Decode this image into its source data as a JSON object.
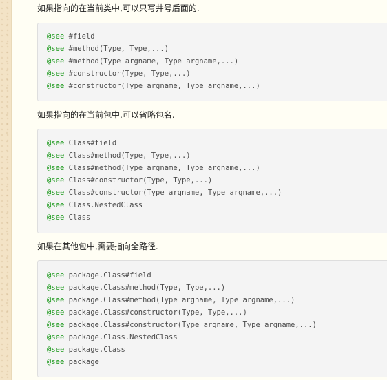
{
  "sections": [
    {
      "description": "如果指向的在当前类中,可以只写井号后面的.",
      "code_lines": [
        {
          "tag": "@see",
          "text": " #field"
        },
        {
          "tag": "@see",
          "text": " #method(Type, Type,...)"
        },
        {
          "tag": "@see",
          "text": " #method(Type argname, Type argname,...)"
        },
        {
          "tag": "@see",
          "text": " #constructor(Type, Type,...)"
        },
        {
          "tag": "@see",
          "text": " #constructor(Type argname, Type argname,...)"
        }
      ]
    },
    {
      "description": "如果指向的在当前包中,可以省略包名.",
      "code_lines": [
        {
          "tag": "@see",
          "text": " Class#field"
        },
        {
          "tag": "@see",
          "text": " Class#method(Type, Type,...)"
        },
        {
          "tag": "@see",
          "text": " Class#method(Type argname, Type argname,...)"
        },
        {
          "tag": "@see",
          "text": " Class#constructor(Type, Type,...)"
        },
        {
          "tag": "@see",
          "text": " Class#constructor(Type argname, Type argname,...)"
        },
        {
          "tag": "@see",
          "text": " Class.NestedClass"
        },
        {
          "tag": "@see",
          "text": " Class"
        }
      ]
    },
    {
      "description": "如果在其他包中,需要指向全路径.",
      "code_lines": [
        {
          "tag": "@see",
          "text": " package.Class#field"
        },
        {
          "tag": "@see",
          "text": " package.Class#method(Type, Type,...)"
        },
        {
          "tag": "@see",
          "text": " package.Class#method(Type argname, Type argname,...)"
        },
        {
          "tag": "@see",
          "text": " package.Class#constructor(Type, Type,...)"
        },
        {
          "tag": "@see",
          "text": " package.Class#constructor(Type argname, Type argname,...)"
        },
        {
          "tag": "@see",
          "text": " package.Class.NestedClass"
        },
        {
          "tag": "@see",
          "text": " package.Class"
        },
        {
          "tag": "@see",
          "text": " package"
        }
      ]
    }
  ],
  "colors": {
    "see_tag": "#1f9a1f",
    "code_text": "#4d4d4d",
    "code_background": "#f4f4f4",
    "page_background": "#fffef4",
    "side_texture": "#f3e3c6"
  }
}
